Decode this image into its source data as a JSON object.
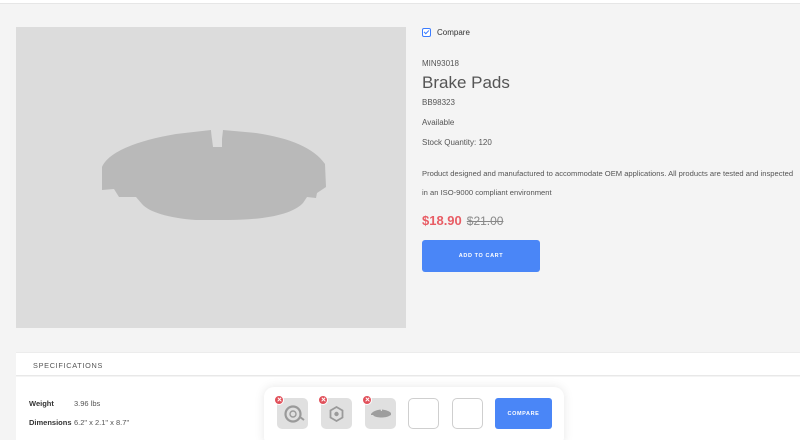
{
  "product": {
    "compare_label": "Compare",
    "compare_checked": true,
    "sku": "MIN93018",
    "title": "Brake Pads",
    "part_number": "BB98323",
    "availability": "Available",
    "stock": "Stock Quantity: 120",
    "description": "Product designed and manufactured to accommodate OEM applications. All products are tested and inspected in an ISO-9000 compliant environment",
    "price_sale": "$18.90",
    "price_original": "$21.00",
    "add_to_cart_label": "ADD TO CART",
    "image_icon": "brake-pad-image"
  },
  "specifications": {
    "title": "SPECIFICATIONS",
    "rows": [
      {
        "key": "Weight",
        "value": "3.96 lbs"
      },
      {
        "key": "Dimensions",
        "value": "6.2\" x 2.1\" x 8.7\""
      }
    ]
  },
  "compare_bar": {
    "items": [
      {
        "icon": "rotor-icon"
      },
      {
        "icon": "part-icon"
      },
      {
        "icon": "brake-pad-icon"
      }
    ],
    "empty_slots": 2,
    "compare_button_label": "COMPARE"
  },
  "colors": {
    "accent": "#4a86f7",
    "sale": "#e85c64",
    "remove": "#e1505a"
  }
}
